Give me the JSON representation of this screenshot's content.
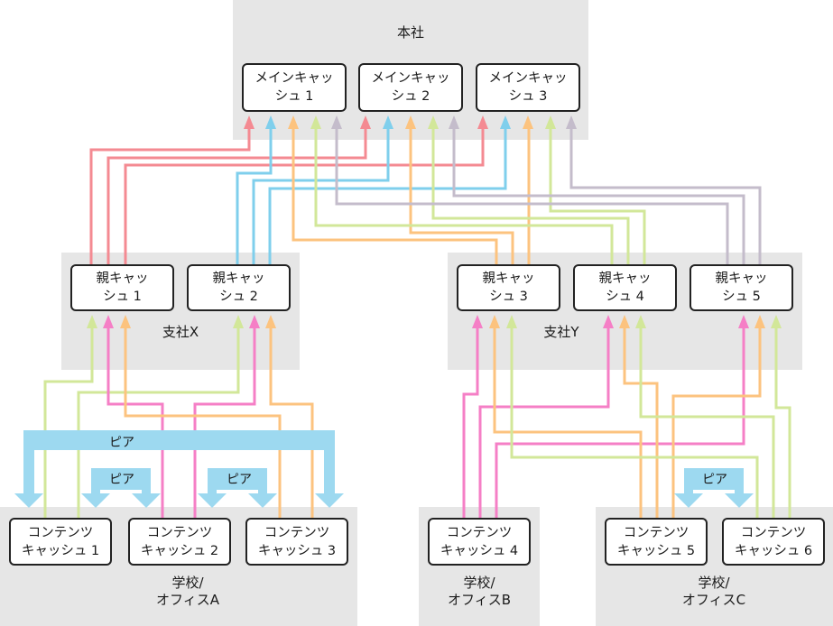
{
  "colors": {
    "region_bg": "#e6e6e6",
    "red": "#f48a92",
    "blue": "#7fcfec",
    "orange": "#fcc37f",
    "green": "#d2e799",
    "purple": "#c4bccb",
    "pink": "#f57fc6",
    "peer": "#9dd9f0"
  },
  "regions": {
    "hq": {
      "label": "本社"
    },
    "branch_x": {
      "label": "支社X"
    },
    "branch_y": {
      "label": "支社Y"
    },
    "site_a": {
      "label": "学校/\nオフィスA"
    },
    "site_b": {
      "label": "学校/\nオフィスB"
    },
    "site_c": {
      "label": "学校/\nオフィスC"
    }
  },
  "nodes": {
    "main1": "メインキャッ\nシュ 1",
    "main2": "メインキャッ\nシュ 2",
    "main3": "メインキャッ\nシュ 3",
    "parent1": "親キャッ\nシュ 1",
    "parent2": "親キャッ\nシュ 2",
    "parent3": "親キャッ\nシュ 3",
    "parent4": "親キャッ\nシュ 4",
    "parent5": "親キャッ\nシュ 5",
    "content1": "コンテンツ\nキャッシュ 1",
    "content2": "コンテンツ\nキャッシュ 2",
    "content3": "コンテンツ\nキャッシュ 3",
    "content4": "コンテンツ\nキャッシュ 4",
    "content5": "コンテンツ\nキャッシュ 5",
    "content6": "コンテンツ\nキャッシュ 6"
  },
  "peers": {
    "outer_a": "ピア",
    "a12": "ピア",
    "a23": "ピア",
    "c56": "ピア"
  },
  "connections": [
    {
      "from": "parent1",
      "to": "main1",
      "color": "red"
    },
    {
      "from": "parent1",
      "to": "main2",
      "color": "red"
    },
    {
      "from": "parent1",
      "to": "main3",
      "color": "red"
    },
    {
      "from": "parent2",
      "to": "main1",
      "color": "blue"
    },
    {
      "from": "parent2",
      "to": "main2",
      "color": "blue"
    },
    {
      "from": "parent2",
      "to": "main3",
      "color": "blue"
    },
    {
      "from": "parent3",
      "to": "main1",
      "color": "orange"
    },
    {
      "from": "parent3",
      "to": "main2",
      "color": "orange"
    },
    {
      "from": "parent3",
      "to": "main3",
      "color": "orange"
    },
    {
      "from": "parent4",
      "to": "main1",
      "color": "green"
    },
    {
      "from": "parent4",
      "to": "main2",
      "color": "green"
    },
    {
      "from": "parent4",
      "to": "main3",
      "color": "green"
    },
    {
      "from": "parent5",
      "to": "main1",
      "color": "purple"
    },
    {
      "from": "parent5",
      "to": "main2",
      "color": "purple"
    },
    {
      "from": "parent5",
      "to": "main3",
      "color": "purple"
    },
    {
      "from": "content1",
      "to": "parent1",
      "color": "green"
    },
    {
      "from": "content1",
      "to": "parent2",
      "color": "green"
    },
    {
      "from": "content2",
      "to": "parent1",
      "color": "pink"
    },
    {
      "from": "content2",
      "to": "parent2",
      "color": "pink"
    },
    {
      "from": "content3",
      "to": "parent1",
      "color": "orange"
    },
    {
      "from": "content3",
      "to": "parent2",
      "color": "orange"
    },
    {
      "from": "content4",
      "to": "parent3",
      "color": "pink"
    },
    {
      "from": "content4",
      "to": "parent4",
      "color": "pink"
    },
    {
      "from": "content4",
      "to": "parent5",
      "color": "pink"
    },
    {
      "from": "content5",
      "to": "parent3",
      "color": "orange"
    },
    {
      "from": "content5",
      "to": "parent4",
      "color": "orange"
    },
    {
      "from": "content5",
      "to": "parent5",
      "color": "orange"
    },
    {
      "from": "content6",
      "to": "parent3",
      "color": "green"
    },
    {
      "from": "content6",
      "to": "parent4",
      "color": "green"
    },
    {
      "from": "content6",
      "to": "parent5",
      "color": "green"
    }
  ]
}
